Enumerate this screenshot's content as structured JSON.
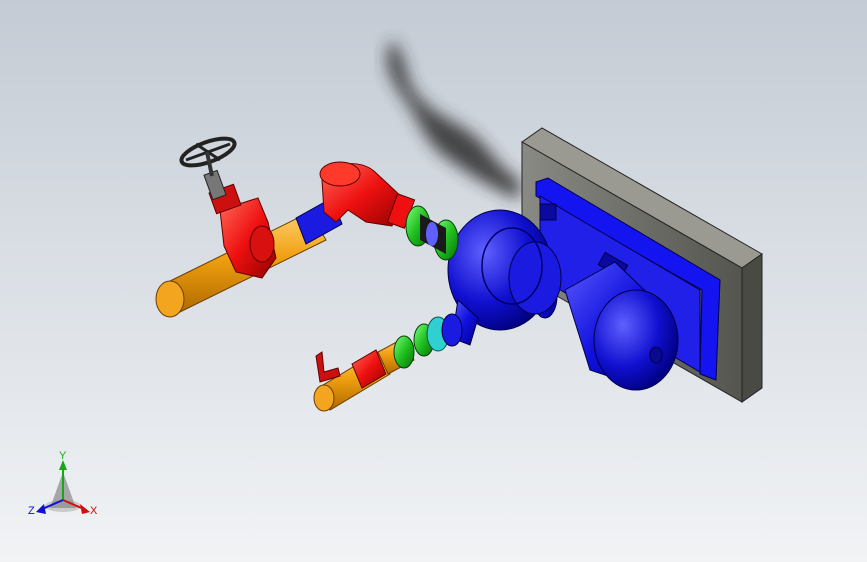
{
  "viewport": {
    "background_top": "#c4cbd4",
    "background_bottom": "#f1f3f5"
  },
  "model": {
    "parts": [
      {
        "name": "wall-mounting-plate",
        "color": "#5e5e59"
      },
      {
        "name": "motor-base-frame",
        "color": "#1010ee"
      },
      {
        "name": "pump-motor",
        "color": "#1010dd"
      },
      {
        "name": "pump-volute",
        "color": "#1010dd"
      },
      {
        "name": "suction-pipe",
        "color": "#f0a010"
      },
      {
        "name": "gate-valve",
        "color": "#ee1010"
      },
      {
        "name": "handwheel",
        "color": "#333333"
      },
      {
        "name": "elbow",
        "color": "#ee1010"
      },
      {
        "name": "flexible-joint",
        "color": "#20c020"
      },
      {
        "name": "flange",
        "color": "#20c0c0"
      },
      {
        "name": "discharge-pipe",
        "color": "#f0a010"
      },
      {
        "name": "check-valve",
        "color": "#ee1010"
      }
    ]
  },
  "triad": {
    "x_label": "X",
    "y_label": "Y",
    "z_label": "Z",
    "x_color": "#d01010",
    "y_color": "#1aa61a",
    "z_color": "#1010d0"
  }
}
